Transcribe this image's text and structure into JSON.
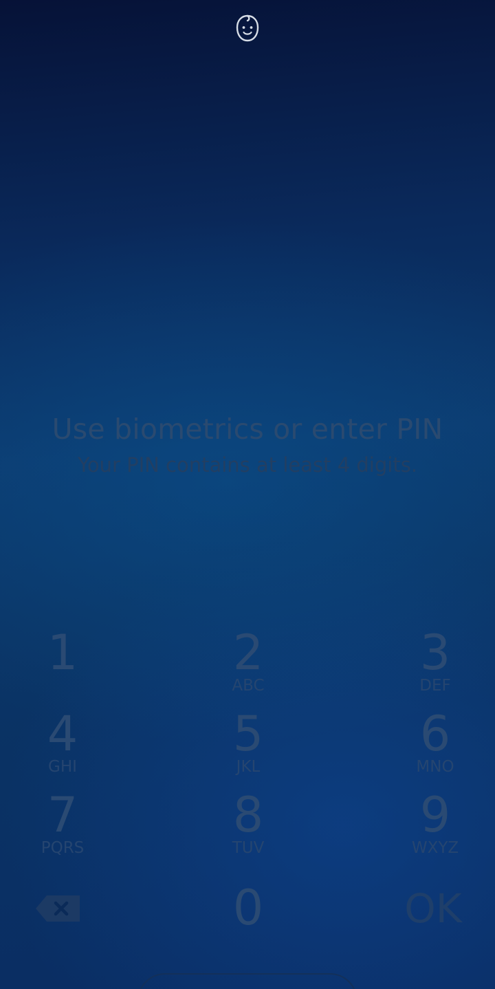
{
  "status_icon": "baby-face-icon",
  "prompt": {
    "title": "Use biometrics or enter PIN",
    "subtitle": "Your PIN contains at least 4 digits."
  },
  "keypad": {
    "keys": [
      {
        "digit": "1",
        "letters": ""
      },
      {
        "digit": "2",
        "letters": "ABC"
      },
      {
        "digit": "3",
        "letters": "DEF"
      },
      {
        "digit": "4",
        "letters": "GHI"
      },
      {
        "digit": "5",
        "letters": "JKL"
      },
      {
        "digit": "6",
        "letters": "MNO"
      },
      {
        "digit": "7",
        "letters": "PQRS"
      },
      {
        "digit": "8",
        "letters": "TUV"
      },
      {
        "digit": "9",
        "letters": "WXYZ"
      },
      {
        "digit": "0",
        "letters": ""
      }
    ],
    "backspace_icon": "backspace-icon",
    "ok_label": "OK"
  },
  "colors": {
    "background_top": "#061237",
    "background_mid": "#0c3a6e",
    "text_dim": "#2a4a70"
  }
}
